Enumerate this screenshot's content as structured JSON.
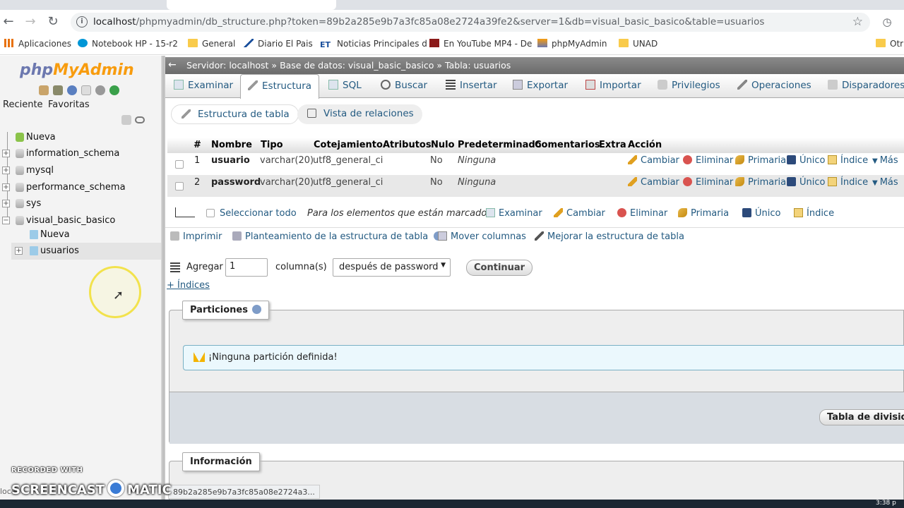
{
  "browser": {
    "url_host": "localhost",
    "url_rest": "/phpmyadmin/db_structure.php?token=89b2a285e9b7a3fc85a08e2724a39fe2&server=1&db=visual_basic_basico&table=usuarios",
    "bookmarks": [
      "Aplicaciones",
      "Notebook HP - 15-r2",
      "General",
      "Diario El Pais",
      "Noticias Principales d",
      "En YouTube MP4 - De",
      "phpMyAdmin",
      "UNAD",
      "Otr"
    ]
  },
  "sidebar": {
    "logo_php": "php",
    "logo_myadmin": "MyAdmin",
    "tabs": [
      "Reciente",
      "Favoritas"
    ],
    "tree": [
      "Nueva",
      "information_schema",
      "mysql",
      "performance_schema",
      "sys",
      "visual_basic_basico"
    ],
    "subtree": [
      "Nueva",
      "usuarios"
    ]
  },
  "breadcrumb": {
    "server": "Servidor: localhost",
    "database": "Base de datos: visual_basic_basico",
    "table": "Tabla: usuarios",
    "sep": "»"
  },
  "tabs": [
    "Examinar",
    "Estructura",
    "SQL",
    "Buscar",
    "Insertar",
    "Exportar",
    "Importar",
    "Privilegios",
    "Operaciones",
    "Disparadores"
  ],
  "subtabs": [
    "Estructura de tabla",
    "Vista de relaciones"
  ],
  "table": {
    "headers": [
      "#",
      "Nombre",
      "Tipo",
      "Cotejamiento",
      "Atributos",
      "Nulo",
      "Predeterminado",
      "Comentarios",
      "Extra",
      "Acción"
    ],
    "rows": [
      {
        "num": "1",
        "name": "usuario",
        "type": "varchar(20)",
        "collation": "utf8_general_ci",
        "null": "No",
        "default": "Ninguna"
      },
      {
        "num": "2",
        "name": "password",
        "type": "varchar(20)",
        "collation": "utf8_general_ci",
        "null": "No",
        "default": "Ninguna"
      }
    ],
    "row_actions": [
      "Cambiar",
      "Eliminar",
      "Primaria",
      "Único",
      "Índice",
      "Más"
    ]
  },
  "bulk": {
    "select_all": "Seleccionar todo",
    "with_selected": "Para los elementos que están marcados:",
    "actions": [
      "Examinar",
      "Cambiar",
      "Eliminar",
      "Primaria",
      "Único",
      "Índice"
    ]
  },
  "tools": [
    "Imprimir",
    "Planteamiento de la estructura de tabla",
    "Mover columnas",
    "Mejorar la estructura de tabla"
  ],
  "add": {
    "label": "Agregar",
    "value": "1",
    "columns_label": "columna(s)",
    "position": "después de password",
    "go": "Continuar"
  },
  "indexes_link": "+ Índices",
  "partitions": {
    "legend": "Particiones",
    "notice": "¡Ninguna partición definida!",
    "button": "Tabla de divisione"
  },
  "info_legend": "Información",
  "status_url": "89b2a285e9b7a3fc85a08e2724a3...",
  "status_prefix": "loca",
  "watermark_top": "RECORDED WITH",
  "watermark_bottom": "SCREENCAST",
  "watermark_matic": "MATIC",
  "clock": "3:38 p"
}
